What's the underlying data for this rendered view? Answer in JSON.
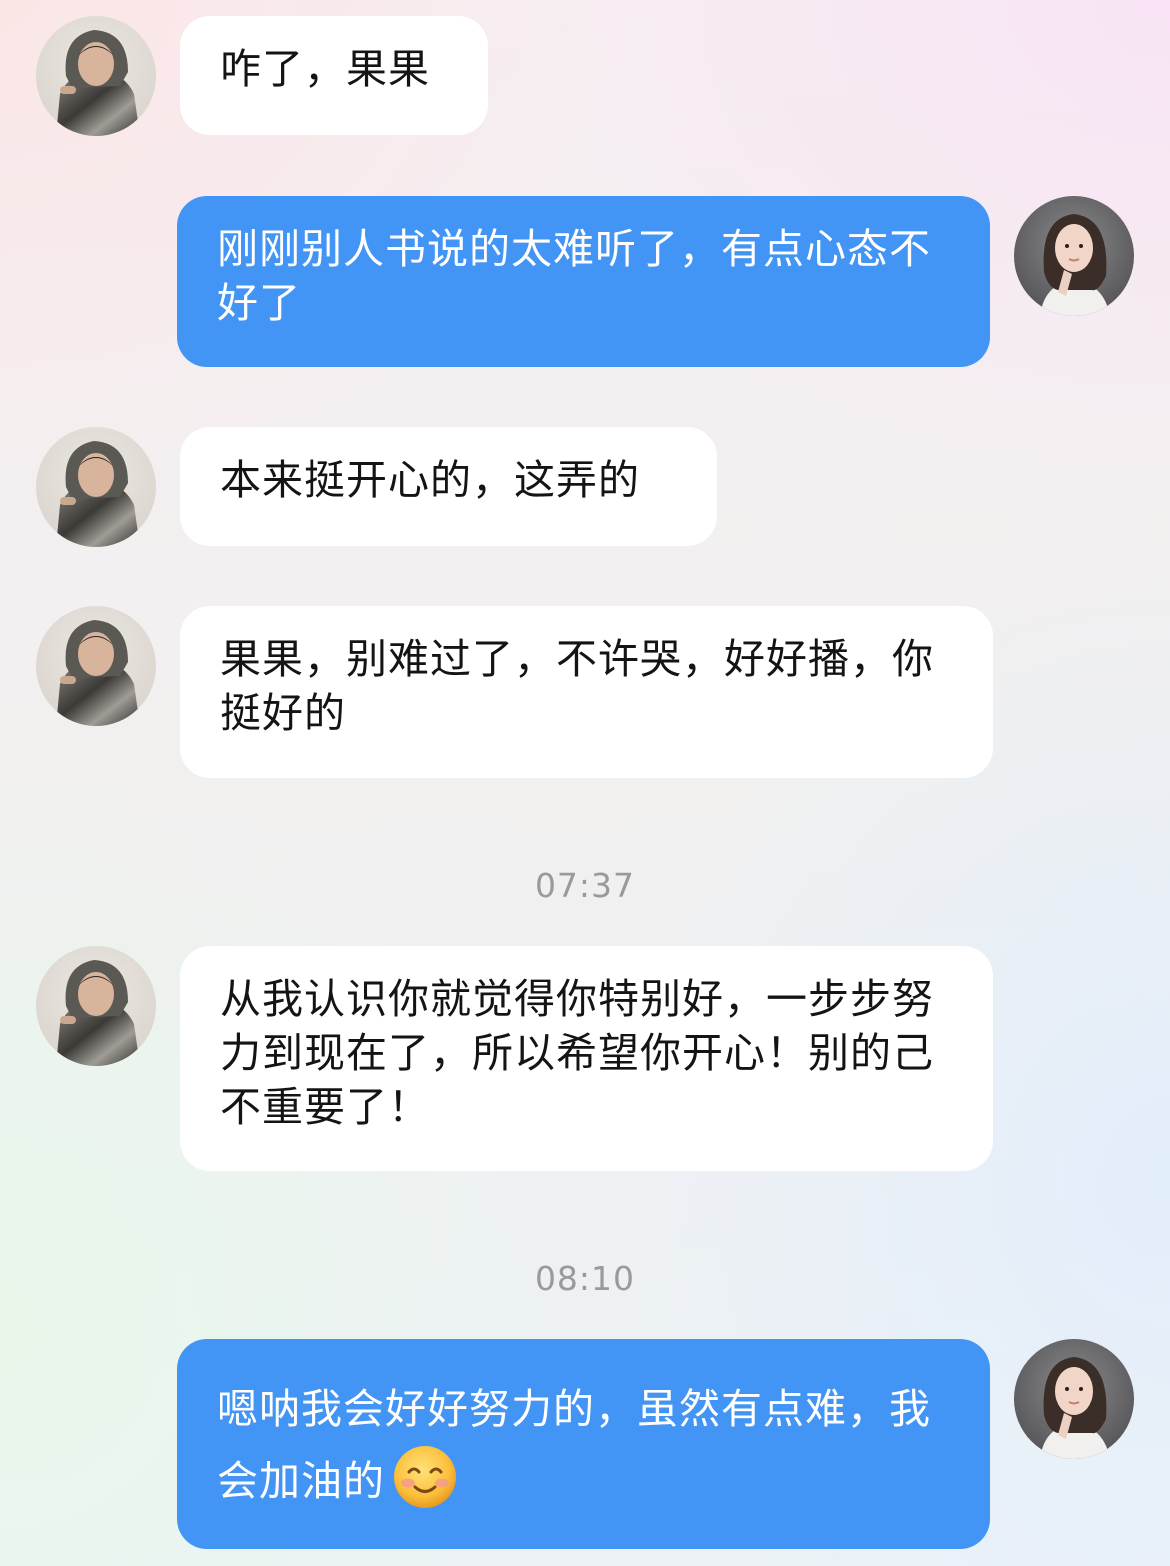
{
  "contacts": {
    "left_avatar": "avatar-hooded-person",
    "right_avatar": "avatar-woman-portrait"
  },
  "colors": {
    "outgoing_bubble": "#4294f5",
    "incoming_bubble": "#ffffff",
    "timestamp_text": "#9a9a9a"
  },
  "messages": [
    {
      "side": "in",
      "text": "咋了，果果"
    },
    {
      "side": "out",
      "text": "刚刚别人书说的太难听了，有点心态不好了"
    },
    {
      "side": "in",
      "text": "本来挺开心的，这弄的"
    },
    {
      "side": "in",
      "text": "果果，别难过了，不许哭，好好播，你挺好的"
    },
    {
      "side": "in",
      "text": "从我认识你就觉得你特别好，一步步努力到现在了，所以希望你开心！别的己不重要了！"
    },
    {
      "side": "out",
      "text": "嗯呐我会好好努力的，虽然有点难，我会加油的",
      "emoji": "smiling-face-with-blush-icon"
    }
  ],
  "timestamps": [
    "07:37",
    "08:10"
  ]
}
